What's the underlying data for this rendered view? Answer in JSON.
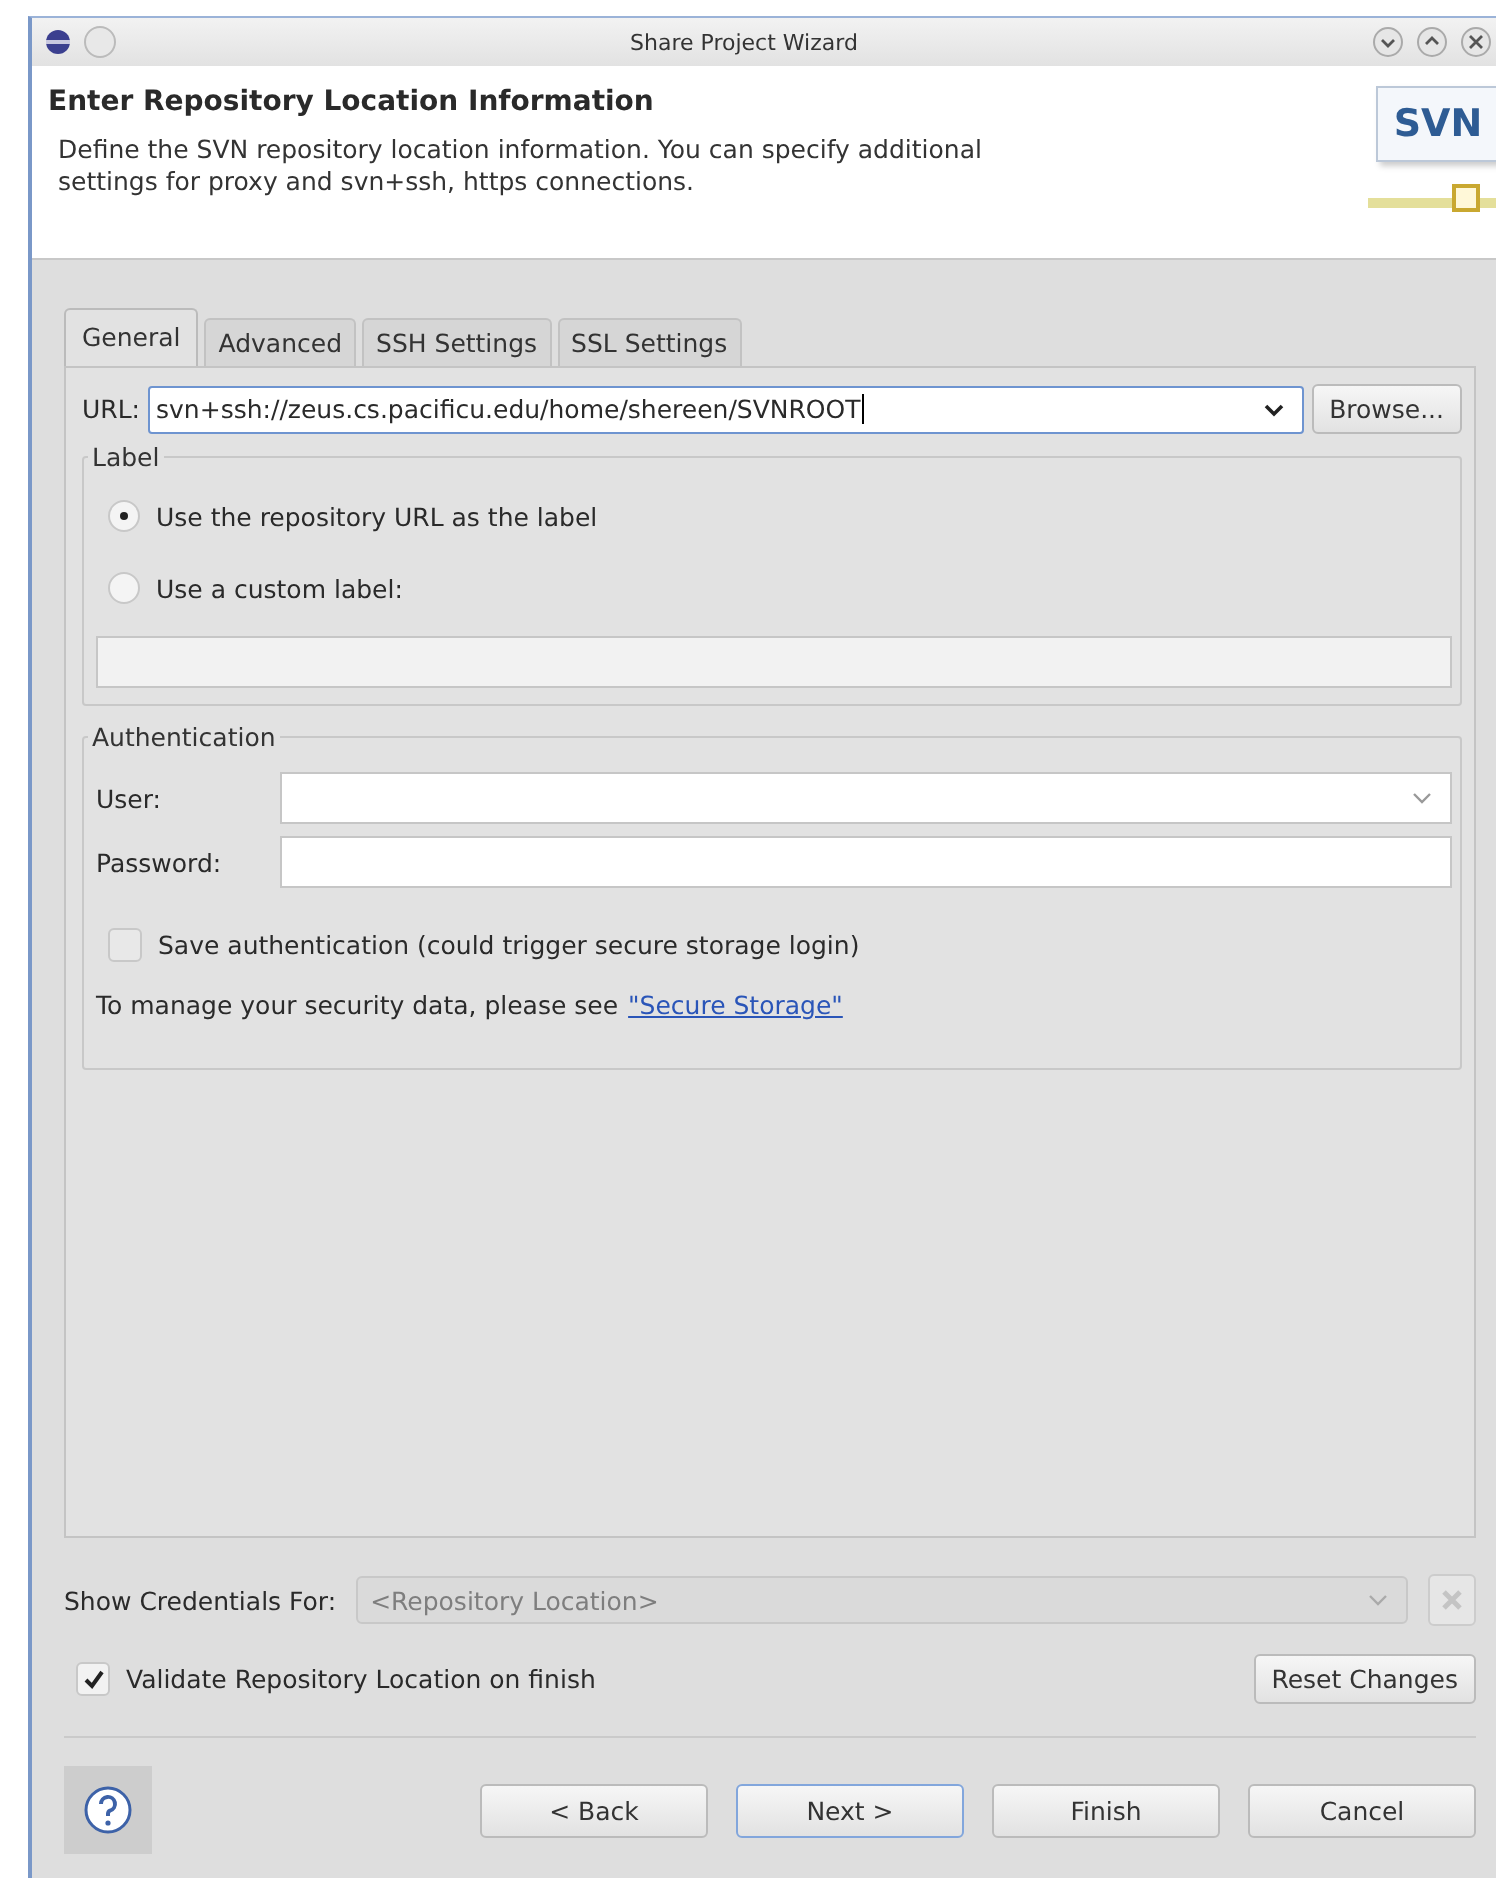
{
  "window": {
    "title": "Share Project Wizard"
  },
  "header": {
    "title": "Enter Repository Location Information",
    "description": "Define the SVN repository location information. You can specify additional settings for proxy and svn+ssh, https connections.",
    "logo_text": "SVN"
  },
  "tabs": [
    {
      "label": "General",
      "selected": true
    },
    {
      "label": "Advanced",
      "selected": false
    },
    {
      "label": "SSH Settings",
      "selected": false
    },
    {
      "label": "SSL Settings",
      "selected": false
    }
  ],
  "url": {
    "label": "URL:",
    "value": "svn+ssh://zeus.cs.pacificu.edu/home/shereen/SVNROOT",
    "browse_button": "Browse..."
  },
  "label_group": {
    "title": "Label",
    "options": [
      {
        "label": "Use the repository URL as the label",
        "selected": true
      },
      {
        "label": "Use a custom label:",
        "selected": false
      }
    ],
    "custom_label_disabled": true
  },
  "authentication": {
    "title": "Authentication",
    "user_label": "User:",
    "password_label": "Password:",
    "save_label": "Save authentication (could trigger secure storage login)",
    "save_checked": false,
    "note": "To manage your security data, please see",
    "link": "\"Secure Storage\""
  },
  "credentials": {
    "label": "Show Credentials For:",
    "placeholder": "<Repository Location>",
    "disabled": true
  },
  "validate": {
    "label": "Validate Repository Location on finish",
    "checked": true
  },
  "reset_button": "Reset Changes",
  "buttons": [
    {
      "label": "< Back",
      "default": false
    },
    {
      "label": "Next >",
      "default": true
    },
    {
      "label": "Finish",
      "default": false
    },
    {
      "label": "Cancel",
      "default": false
    }
  ]
}
